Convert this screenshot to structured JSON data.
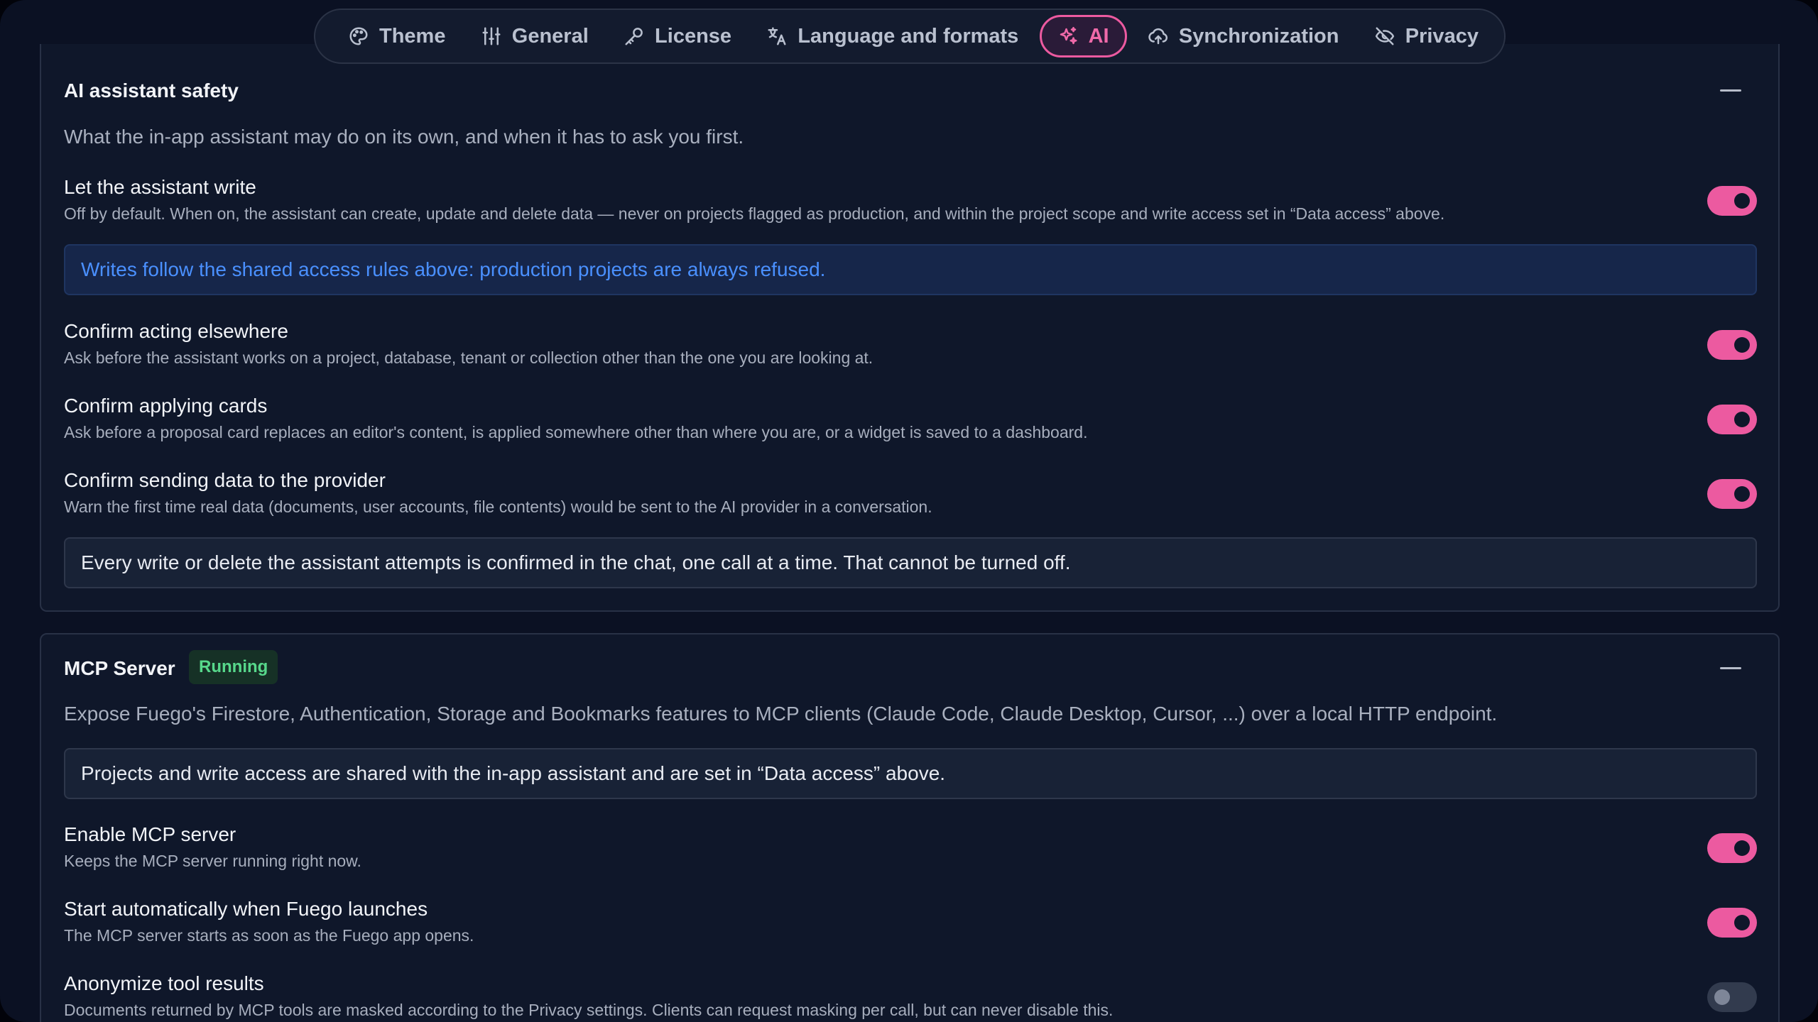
{
  "nav": {
    "tabs": [
      {
        "label": "Theme",
        "icon": "palette-icon"
      },
      {
        "label": "General",
        "icon": "sliders-icon"
      },
      {
        "label": "License",
        "icon": "key-icon"
      },
      {
        "label": "Language and formats",
        "icon": "translate-icon"
      },
      {
        "label": "AI",
        "icon": "sparkles-icon",
        "active": true
      },
      {
        "label": "Synchronization",
        "icon": "cloud-upload-icon"
      },
      {
        "label": "Privacy",
        "icon": "eye-off-icon"
      }
    ]
  },
  "safety": {
    "title": "AI assistant safety",
    "description": "What the in-app assistant may do on its own, and when it has to ask you first.",
    "write": {
      "title": "Let the assistant write",
      "subtitle": "Off by default. When on, the assistant can create, update and delete data — never on projects flagged as production, and within the project scope and write access set in “Data access” above.",
      "enabled": true
    },
    "write_notice": "Writes follow the shared access rules above: production projects are always refused.",
    "elsewhere": {
      "title": "Confirm acting elsewhere",
      "subtitle": "Ask before the assistant works on a project, database, tenant or collection other than the one you are looking at.",
      "enabled": true
    },
    "cards": {
      "title": "Confirm applying cards",
      "subtitle": "Ask before a proposal card replaces an editor's content, is applied somewhere other than where you are, or a widget is saved to a dashboard.",
      "enabled": true
    },
    "provider": {
      "title": "Confirm sending data to the provider",
      "subtitle": "Warn the first time real data (documents, user accounts, file contents) would be sent to the AI provider in a conversation.",
      "enabled": true
    },
    "confirm_notice": "Every write or delete the assistant attempts is confirmed in the chat, one call at a time. That cannot be turned off."
  },
  "mcp": {
    "title": "MCP Server",
    "status": "Running",
    "description": "Expose Fuego's Firestore, Authentication, Storage and Bookmarks features to MCP clients (Claude Code, Claude Desktop, Cursor, ...) over a local HTTP endpoint.",
    "shared_notice": "Projects and write access are shared with the in-app assistant and are set in “Data access” above.",
    "enable": {
      "title": "Enable MCP server",
      "subtitle": "Keeps the MCP server running right now.",
      "enabled": true
    },
    "autostart": {
      "title": "Start automatically when Fuego launches",
      "subtitle": "The MCP server starts as soon as the Fuego app opens.",
      "enabled": true
    },
    "anonymize": {
      "title": "Anonymize tool results",
      "subtitle": "Documents returned by MCP tools are masked according to the Privacy settings. Clients can request masking per call, but can never disable this.",
      "enabled": false
    }
  },
  "colors": {
    "accent": "#ec5aa0",
    "info_text": "#4a90ff",
    "running_badge": "#57d88b",
    "background": "#0b1123"
  }
}
